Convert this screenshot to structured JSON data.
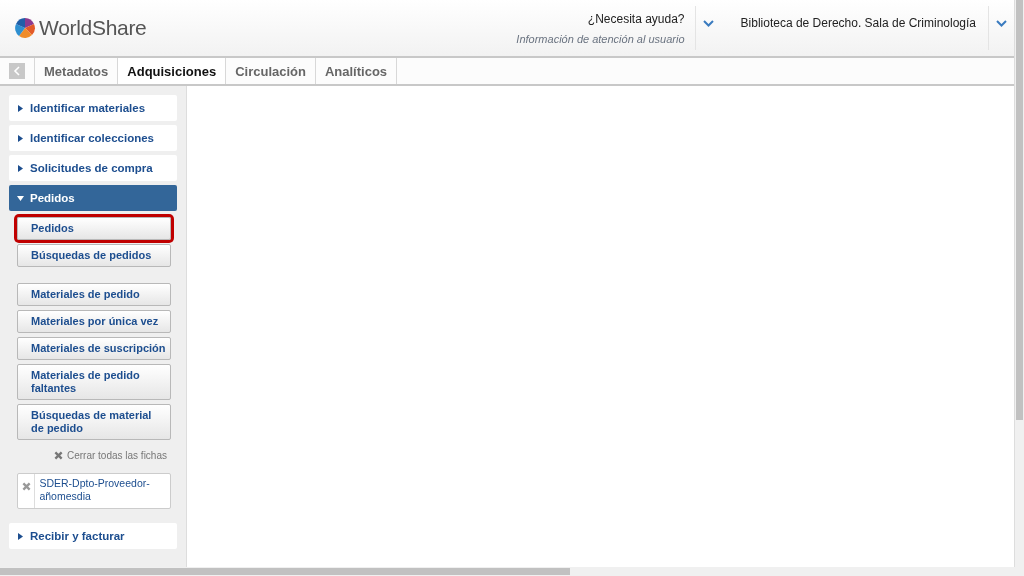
{
  "header": {
    "logo": "WorldShare",
    "help": {
      "title": "¿Necesita ayuda?",
      "subtitle": "Información de atención al usuario"
    },
    "institution": "Biblioteca de Derecho. Sala de Criminología"
  },
  "tabs": [
    {
      "label": "Metadatos",
      "selected": false
    },
    {
      "label": "Adquisiciones",
      "selected": true
    },
    {
      "label": "Circulación",
      "selected": false
    },
    {
      "label": "Analíticos",
      "selected": false
    }
  ],
  "sidebar": {
    "sections": [
      {
        "label": "Identificar materiales",
        "expanded": false
      },
      {
        "label": "Identificar colecciones",
        "expanded": false
      },
      {
        "label": "Solicitudes de compra",
        "expanded": false
      },
      {
        "label": "Pedidos",
        "expanded": true,
        "groups": [
          {
            "items": [
              {
                "label": "Pedidos",
                "highlighted": true
              },
              {
                "label": "Búsquedas de pedidos",
                "highlighted": false
              }
            ]
          },
          {
            "items": [
              {
                "label": "Materiales de pedido",
                "highlighted": false
              },
              {
                "label": "Materiales por única vez",
                "highlighted": false
              },
              {
                "label": "Materiales de suscripción",
                "highlighted": false
              },
              {
                "label": "Materiales de pedido faltantes",
                "highlighted": false
              },
              {
                "label": "Búsquedas de material de pedido",
                "highlighted": false
              }
            ]
          }
        ],
        "close_all": "Cerrar todas las fichas",
        "open_records": [
          {
            "label": "SDER-Dpto-Proveedor-añomesdia"
          }
        ]
      },
      {
        "label": "Recibir y facturar",
        "expanded": false
      }
    ]
  }
}
